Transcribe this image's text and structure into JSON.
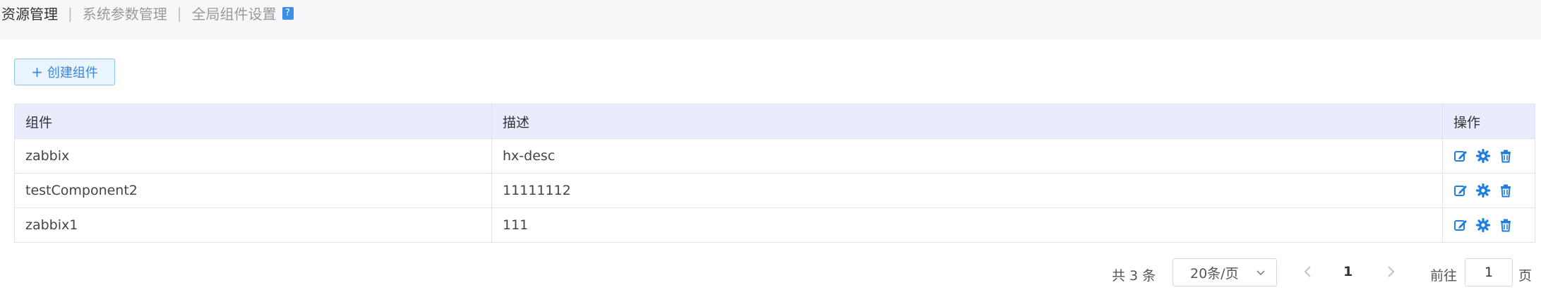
{
  "tabs": [
    {
      "label": "资源管理"
    },
    {
      "label": "系统参数管理"
    },
    {
      "label": "全局组件设置"
    }
  ],
  "tab_separator": "|",
  "help_icon_text": "?",
  "create_button": {
    "icon": "plus-icon",
    "label": "创建组件"
  },
  "table": {
    "headers": [
      "组件",
      "描述",
      "操作"
    ],
    "rows": [
      {
        "name": "zabbix",
        "desc": "hx-desc"
      },
      {
        "name": "testComponent2",
        "desc": "11111112"
      },
      {
        "name": "zabbix1",
        "desc": "111"
      }
    ],
    "row_actions": [
      "edit-icon",
      "gear-icon",
      "trash-icon"
    ]
  },
  "pagination": {
    "total": "共 3 条",
    "page_size": "20条/页",
    "current_page": "1",
    "goto_label": "前往",
    "goto_value": "1",
    "page_unit": "页"
  },
  "colors": {
    "accent": "#1f7ee0",
    "header_bg": "#e8ecfc",
    "button_bg": "#e9f4ff"
  }
}
